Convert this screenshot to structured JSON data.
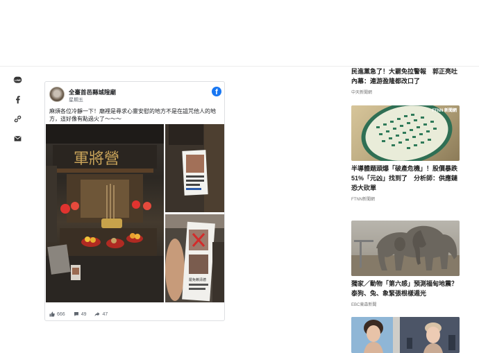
{
  "share_bar": {
    "line_label": "LINE"
  },
  "facebook_post": {
    "page_name": "全臺首邑縣城隍廟",
    "date": "星期五",
    "text": "麻煩各位冷靜一下！廟裡是尋求心靈安慰的地方不是在詛咒他人的地方，這好像有點過火了～～～",
    "stats": {
      "likes": "666",
      "comments": "49",
      "shares": "47"
    },
    "plaque_text": "軍將營",
    "photo_caption": "罷免賴清德"
  },
  "news": [
    {
      "title": "民進黨急了！大罷免拉警報　郭正亮吐內幕：連游盈隆都改口了",
      "source": "中天新聞網"
    },
    {
      "title": "半導體題頭爆「破產危機」！股價暴跌51%「元凶」找到了　分析師：供應鏈恐大砍單",
      "source": "FTNN新聞網",
      "thumb_tag": "FTNN 新聞網"
    },
    {
      "title": "獨家／動物「第六感」預測福甸地震？ 泰狗、兔、象緊張根樣遁光",
      "source": "EBC東森新聞"
    },
    {
      "title": "",
      "source": ""
    }
  ]
}
